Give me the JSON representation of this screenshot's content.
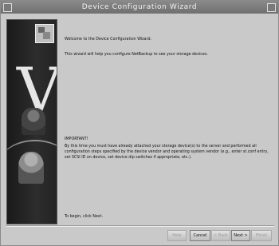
{
  "window": {
    "title": "Device Configuration Wizard"
  },
  "content": {
    "welcome": "Welcome to the Device Configuration Wizard.",
    "intro": "This wizard will help you configure NetBackup to see your storage devices.",
    "important_heading": "IMPORTANT!",
    "important_body": "By this time you must have already attached your storage device(s) to the server and performed all configuration steps specified by the device vendor and operating system vendor (e.g., enter st.conf entry, set SCSI ID on device, set device dip switches if appropriate, etc.).",
    "begin": "To begin, click Next."
  },
  "buttons": {
    "help": "Help",
    "cancel": "Cancel",
    "back": "< Back",
    "next": "Next >",
    "finish": "Finish"
  },
  "icons": {
    "side_graphic": "wizard-banner",
    "logo": "device-logo"
  }
}
